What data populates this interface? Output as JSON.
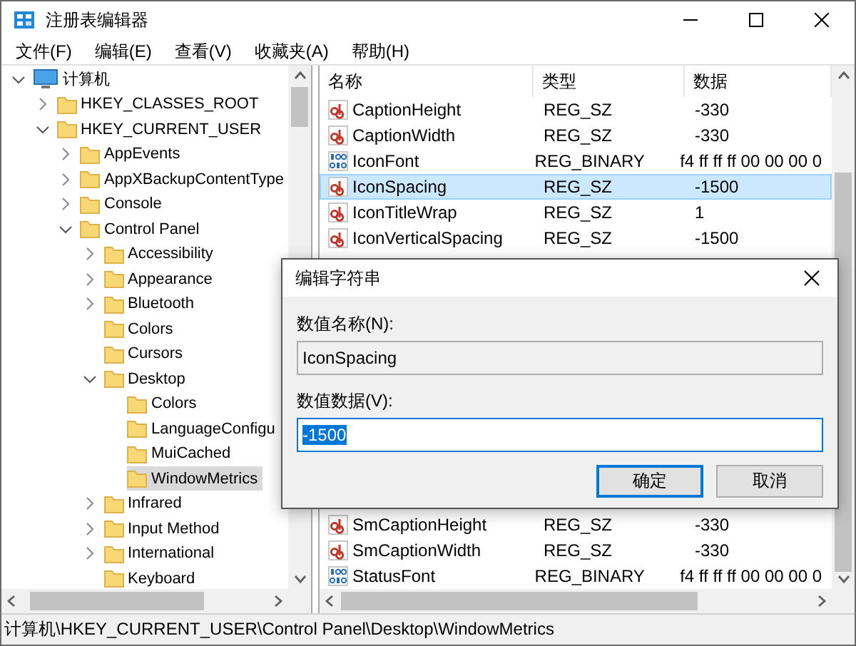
{
  "window": {
    "title": "注册表编辑器"
  },
  "menu": [
    "文件(F)",
    "编辑(E)",
    "查看(V)",
    "收藏夹(A)",
    "帮助(H)"
  ],
  "tree": [
    {
      "label": "计算机",
      "kind": "computer",
      "expanded": true,
      "selected": false,
      "children": [
        {
          "label": "HKEY_CLASSES_ROOT",
          "kind": "folder",
          "expanded": false,
          "selected": false
        },
        {
          "label": "HKEY_CURRENT_USER",
          "kind": "folder",
          "expanded": true,
          "selected": false,
          "children": [
            {
              "label": "AppEvents",
              "kind": "folder",
              "expanded": false,
              "selected": false
            },
            {
              "label": "AppXBackupContentType",
              "kind": "folder",
              "expanded": false,
              "selected": false
            },
            {
              "label": "Console",
              "kind": "folder",
              "expanded": false,
              "selected": false
            },
            {
              "label": "Control Panel",
              "kind": "folder",
              "expanded": true,
              "selected": false,
              "children": [
                {
                  "label": "Accessibility",
                  "kind": "folder",
                  "expanded": false,
                  "selected": false
                },
                {
                  "label": "Appearance",
                  "kind": "folder",
                  "expanded": false,
                  "selected": false
                },
                {
                  "label": "Bluetooth",
                  "kind": "folder",
                  "expanded": false,
                  "selected": false
                },
                {
                  "label": "Colors",
                  "kind": "folder",
                  "selected": false
                },
                {
                  "label": "Cursors",
                  "kind": "folder",
                  "selected": false
                },
                {
                  "label": "Desktop",
                  "kind": "folder",
                  "expanded": true,
                  "selected": false,
                  "children": [
                    {
                      "label": "Colors",
                      "kind": "folder",
                      "selected": false
                    },
                    {
                      "label": "LanguageConfigu",
                      "kind": "folder",
                      "selected": false
                    },
                    {
                      "label": "MuiCached",
                      "kind": "folder",
                      "selected": false
                    },
                    {
                      "label": "WindowMetrics",
                      "kind": "folder",
                      "selected": true
                    }
                  ]
                },
                {
                  "label": "Infrared",
                  "kind": "folder",
                  "expanded": false,
                  "selected": false
                },
                {
                  "label": "Input Method",
                  "kind": "folder",
                  "expanded": false,
                  "selected": false
                },
                {
                  "label": "International",
                  "kind": "folder",
                  "expanded": false,
                  "selected": false
                },
                {
                  "label": "Keyboard",
                  "kind": "folder",
                  "selected": false
                }
              ]
            }
          ]
        }
      ]
    }
  ],
  "list": {
    "columns": [
      "名称",
      "类型",
      "数据"
    ],
    "rows_top": [
      {
        "name": "CaptionHeight",
        "type": "REG_SZ",
        "data": "-330",
        "kind": "string",
        "selected": false
      },
      {
        "name": "CaptionWidth",
        "type": "REG_SZ",
        "data": "-330",
        "kind": "string",
        "selected": false
      },
      {
        "name": "IconFont",
        "type": "REG_BINARY",
        "data": "f4 ff ff ff 00 00 00 0",
        "kind": "binary",
        "selected": false
      },
      {
        "name": "IconSpacing",
        "type": "REG_SZ",
        "data": "-1500",
        "kind": "string",
        "selected": true
      },
      {
        "name": "IconTitleWrap",
        "type": "REG_SZ",
        "data": "1",
        "kind": "string",
        "selected": false
      },
      {
        "name": "IconVerticalSpacing",
        "type": "REG_SZ",
        "data": "-1500",
        "kind": "string",
        "selected": false
      }
    ],
    "rows_bottom": [
      {
        "name": "SmCaptionHeight",
        "type": "REG_SZ",
        "data": "-330",
        "kind": "string",
        "selected": false
      },
      {
        "name": "SmCaptionWidth",
        "type": "REG_SZ",
        "data": "-330",
        "kind": "string",
        "selected": false
      },
      {
        "name": "StatusFont",
        "type": "REG_BINARY",
        "data": "f4 ff ff ff 00 00 00 0",
        "kind": "binary",
        "selected": false
      }
    ]
  },
  "dialog": {
    "title": "编辑字符串",
    "fields": [
      {
        "label": "数值名称(N):",
        "value": "IconSpacing",
        "readonly": true,
        "text_selected": false
      },
      {
        "label": "数值数据(V):",
        "value": "-1500",
        "readonly": false,
        "text_selected": true
      }
    ],
    "buttons": [
      {
        "label": "确定",
        "default": true
      },
      {
        "label": "取消",
        "default": false
      }
    ]
  },
  "status_bar": "计算机\\HKEY_CURRENT_USER\\Control Panel\\Desktop\\WindowMetrics"
}
